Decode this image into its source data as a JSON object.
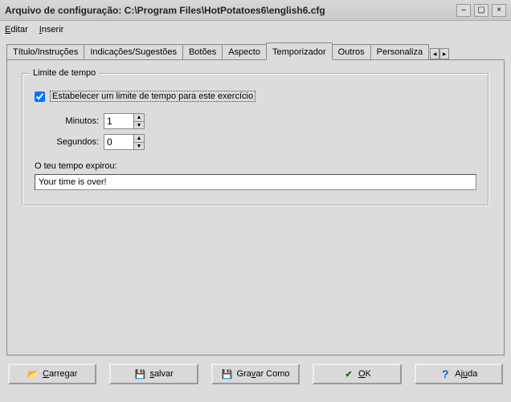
{
  "window": {
    "title": "Arquivo de configuração: C:\\Program Files\\HotPotatoes6\\english6.cfg"
  },
  "menu": {
    "edit": "Editar",
    "insert": "Inserir"
  },
  "tabs": {
    "t0": "Título/Instruções",
    "t1": "Indicações/Sugestões",
    "t2": "Botões",
    "t3": "Aspecto",
    "t4": "Temporizador",
    "t5": "Outros",
    "t6": "Personaliza"
  },
  "timer": {
    "legend": "Limite de tempo",
    "set_limit": "Estabelecer um limite de tempo para este exercício",
    "minutes_label": "Minutos:",
    "minutes_value": "1",
    "seconds_label": "Segundos:",
    "seconds_value": "0",
    "expired_label": "O teu tempo expirou:",
    "expired_value": "Your time is over!"
  },
  "buttons": {
    "load": "Carregar",
    "save": "salvar",
    "save_as": "Gravar Como",
    "ok": "OK",
    "help": "Ajuda"
  },
  "icons": {
    "folder": "📂",
    "disk": "💾",
    "check": "✔",
    "help": "?"
  },
  "colors": {
    "check": "#0a7a0a",
    "help": "#0066cc"
  }
}
